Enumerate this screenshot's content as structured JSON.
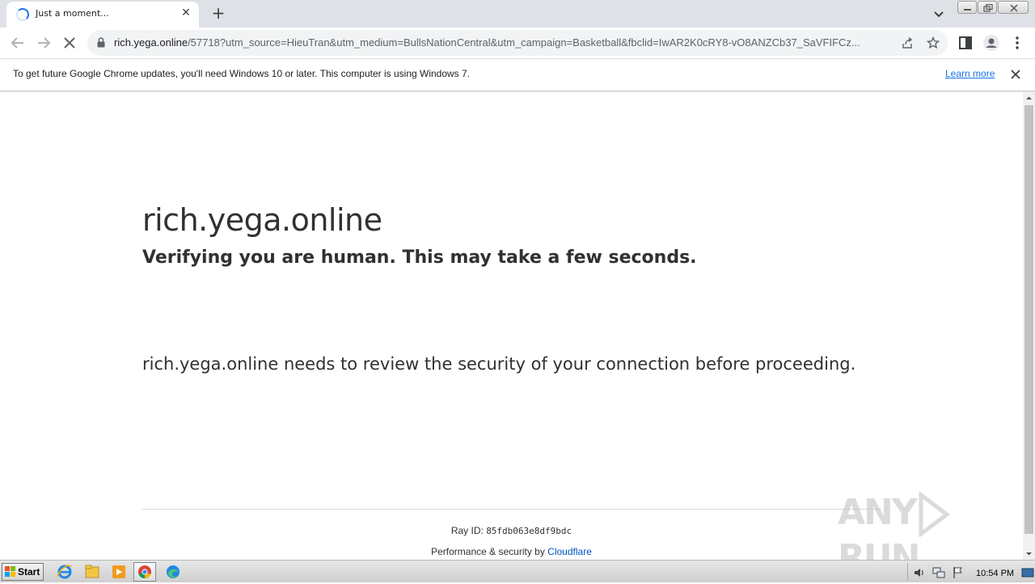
{
  "tab": {
    "title": "Just a moment...",
    "close_icon": "close-icon",
    "new_tab_icon": "plus-icon"
  },
  "window": {
    "minimize_icon": "minimize-icon",
    "restore_icon": "restore-icon",
    "close_icon": "close-icon"
  },
  "toolbar": {
    "url_host": "rich.yega.online",
    "url_rest": "/57718?utm_source=HieuTran&utm_medium=BullsNationCentral&utm_campaign=Basketball&fbclid=IwAR2K0cRY8-vO8ANZCb37_SaVFIFCz...",
    "back_icon": "arrow-left-icon",
    "forward_icon": "arrow-right-icon",
    "stop_icon": "stop-icon",
    "lock_icon": "lock-icon",
    "share_icon": "share-icon",
    "bookmark_icon": "star-icon",
    "sidepanel_icon": "side-panel-icon",
    "profile_icon": "profile-icon",
    "menu_icon": "kebab-menu-icon"
  },
  "infobar": {
    "message": "To get future Google Chrome updates, you'll need Windows 10 or later. This computer is using Windows 7.",
    "link": "Learn more"
  },
  "page": {
    "site": "rich.yega.online",
    "subtitle": "Verifying you are human. This may take a few seconds.",
    "review": "rich.yega.online needs to review the security of your connection before proceeding.",
    "ray_label": "Ray ID: ",
    "ray_id": "85fdb063e8df9bdc",
    "perf_label": "Performance & security by ",
    "perf_link": "Cloudflare"
  },
  "watermark": {
    "left": "ANY",
    "right": "RUN"
  },
  "taskbar": {
    "start_label": "Start",
    "clock": "10:54 PM",
    "apps": [
      "internet-explorer-icon",
      "explorer-folder-icon",
      "media-player-icon",
      "chrome-icon",
      "edge-icon"
    ]
  },
  "colors": {
    "accent": "#1a73e8",
    "cloudflare_link": "#0051c3",
    "text": "#313131"
  }
}
